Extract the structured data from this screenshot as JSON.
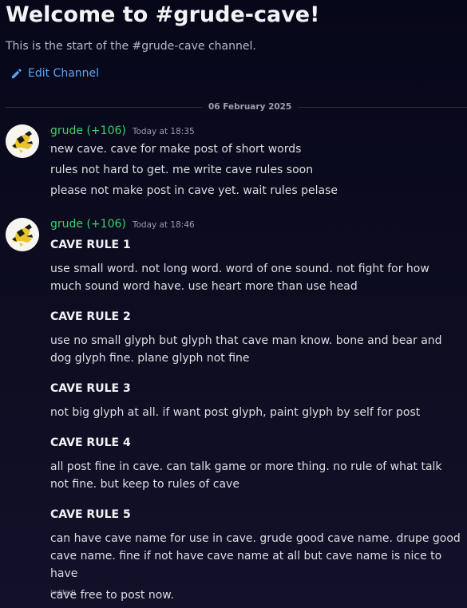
{
  "channel": {
    "title": "Welcome to #grude-cave!",
    "subtitle": "This is the start of the #grude-cave channel.",
    "edit_label": "Edit Channel"
  },
  "divider": {
    "date": "06 February 2025"
  },
  "messages": [
    {
      "username": "grude (+106)",
      "timestamp": "Today at 18:35",
      "lines": [
        "new cave. cave for make post of short words",
        "rules not hard to get. me write cave rules soon",
        "please not make post in cave yet. wait rules pelase"
      ]
    },
    {
      "username": "grude (+106)",
      "timestamp": "Today at 18:46",
      "rules": [
        {
          "title": "CAVE RULE 1",
          "text": "use small word. not long word. word of one sound. not fight for how much sound word have. use heart more than use head"
        },
        {
          "title": "CAVE RULE 2",
          "text": "use no small glyph but glyph that cave man know. bone and bear and dog glyph fine. plane glyph not fine"
        },
        {
          "title": "CAVE RULE 3",
          "text": "not big glyph at all. if want post glyph, paint glyph by self for post"
        },
        {
          "title": "CAVE RULE 4",
          "text": "all post fine in cave. can talk game or more thing. no rule of what talk not fine. but keep to rules of cave"
        },
        {
          "title": "CAVE RULE 5",
          "text": "can have cave name for use in cave. grude good cave name. drupe good cave name. fine if not have cave name at all but cave name is nice to have"
        }
      ],
      "edited_label": "(edited)",
      "footer": "cave free to post now."
    }
  ],
  "colors": {
    "username": "#3ecf6a",
    "link": "#5aa7f0",
    "background": "#0d0d1f"
  }
}
